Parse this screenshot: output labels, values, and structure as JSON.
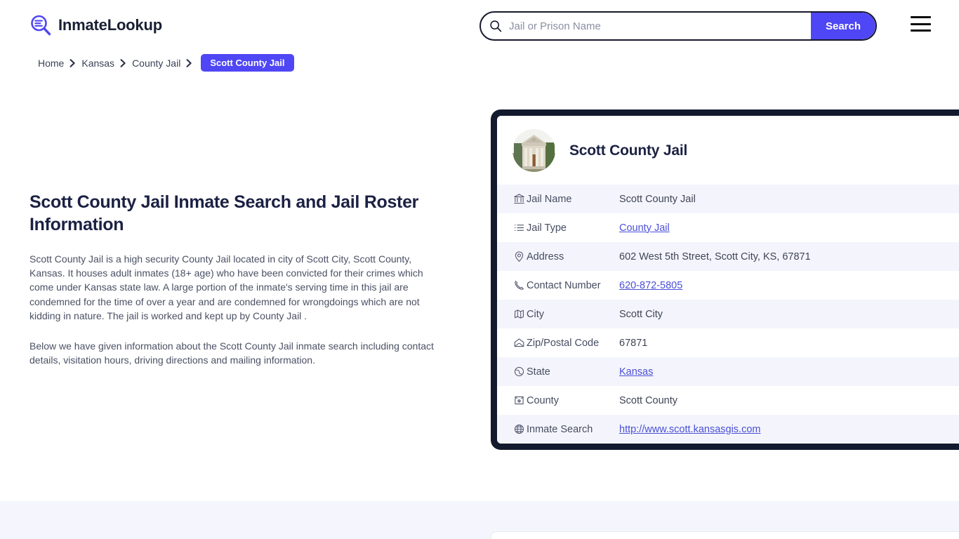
{
  "header": {
    "logo_text": "InmateLookup",
    "logo_icon": "magnifier-list-icon",
    "search": {
      "placeholder": "Jail or Prison Name",
      "value": "",
      "button_label": "Search",
      "icon": "search-icon"
    },
    "menu_icon": "hamburger-menu-icon"
  },
  "breadcrumb": {
    "items": [
      {
        "label": "Home",
        "current": false
      },
      {
        "label": "Kansas",
        "current": false
      },
      {
        "label": "County Jail",
        "current": false
      },
      {
        "label": "Scott County Jail",
        "current": true
      }
    ],
    "separator_icon": "chevron-right-icon"
  },
  "main": {
    "title": "Scott County Jail Inmate Search and Jail Roster Information",
    "paragraphs": [
      "Scott County Jail is a high security County Jail located in city of Scott City, Scott County, Kansas. It houses adult inmates (18+ age) who have been convicted for their crimes which come under Kansas state law. A large portion of the inmate's serving time in this jail are condemned for the time of over a year and are condemned for wrongdoings which are not kidding in nature. The jail is worked and kept up by County Jail .",
      "Below we have given information about the Scott County Jail inmate search including contact details, visitation hours, driving directions and mailing information."
    ]
  },
  "jail_card": {
    "title": "Scott County Jail",
    "avatar_icon": "courthouse-photo",
    "rows": [
      {
        "icon": "bank-icon",
        "label": "Jail Name",
        "value": "Scott County Jail",
        "link": false
      },
      {
        "icon": "list-icon",
        "label": "Jail Type",
        "value": "County Jail",
        "link": true
      },
      {
        "icon": "map-pin-icon",
        "label": "Address",
        "value": "602 West 5th Street, Scott City, KS, 67871",
        "link": false
      },
      {
        "icon": "phone-icon",
        "label": "Contact Number",
        "value": "620-872-5805",
        "link": true
      },
      {
        "icon": "map-icon",
        "label": "City",
        "value": "Scott City",
        "link": false
      },
      {
        "icon": "envelope-icon",
        "label": "Zip/Postal Code",
        "value": "67871",
        "link": false
      },
      {
        "icon": "globe-grid-icon",
        "label": "State",
        "value": "Kansas",
        "link": true
      },
      {
        "icon": "county-badge-icon",
        "label": "County",
        "value": "Scott County",
        "link": false
      },
      {
        "icon": "globe-icon",
        "label": "Inmate Search",
        "value": "http://www.scott.kansasgis.com",
        "link": true
      }
    ]
  },
  "colors": {
    "accent_blue": "#4f46f5",
    "link_blue": "#4a4fd6",
    "card_border_navy": "#131a2e",
    "heading_navy": "#1b2143",
    "row_alt": "#f4f5fc",
    "band_lavender": "#f5f5fd"
  }
}
